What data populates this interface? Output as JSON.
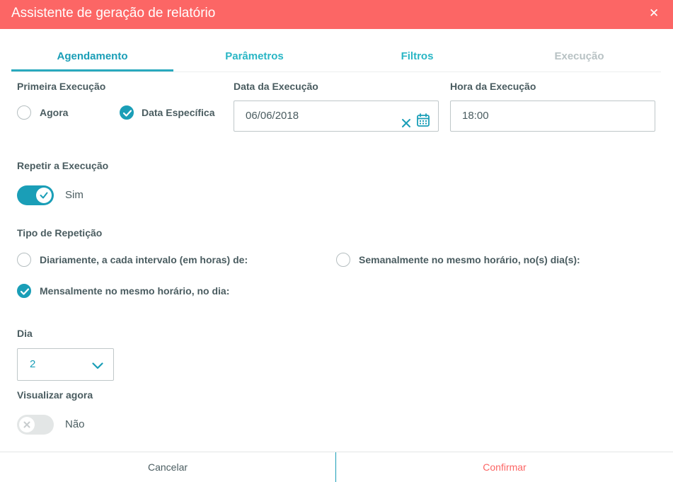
{
  "dialog": {
    "title": "Assistente de geração de relatório",
    "close_icon": "close-icon"
  },
  "tabs": [
    {
      "label": "Agendamento",
      "state": "active"
    },
    {
      "label": "Parâmetros",
      "state": "enabled"
    },
    {
      "label": "Filtros",
      "state": "enabled"
    },
    {
      "label": "Execução",
      "state": "disabled"
    }
  ],
  "primeira_execucao": {
    "label": "Primeira Execução",
    "options": [
      {
        "label": "Agora",
        "checked": false
      },
      {
        "label": "Data Específica",
        "checked": true
      }
    ]
  },
  "data_execucao": {
    "label": "Data da Execução",
    "value": "06/06/2018",
    "clear_icon": "clear-icon",
    "calendar_icon": "calendar-icon"
  },
  "hora_execucao": {
    "label": "Hora da Execução",
    "value": "18:00"
  },
  "repetir": {
    "label": "Repetir a Execução",
    "on": true,
    "value_label": "Sim"
  },
  "tipo_repeticao": {
    "label": "Tipo de Repetição",
    "options": [
      {
        "label": "Diariamente, a cada intervalo (em horas) de:",
        "checked": false
      },
      {
        "label": "Semanalmente no mesmo horário, no(s) dia(s):",
        "checked": false
      },
      {
        "label": "Mensalmente no mesmo horário, no dia:",
        "checked": true
      }
    ]
  },
  "dia": {
    "label": "Dia",
    "value": "2"
  },
  "visualizar": {
    "label": "Visualizar agora",
    "on": false,
    "value_label": "Não"
  },
  "footer": {
    "cancel_label": "Cancelar",
    "confirm_label": "Confirmar"
  },
  "colors": {
    "header": "#fc6665",
    "accent": "#1a9eb7",
    "tab_enabled": "#29b6c5",
    "tab_disabled": "#b8c2c4",
    "text": "#4a5c60"
  }
}
